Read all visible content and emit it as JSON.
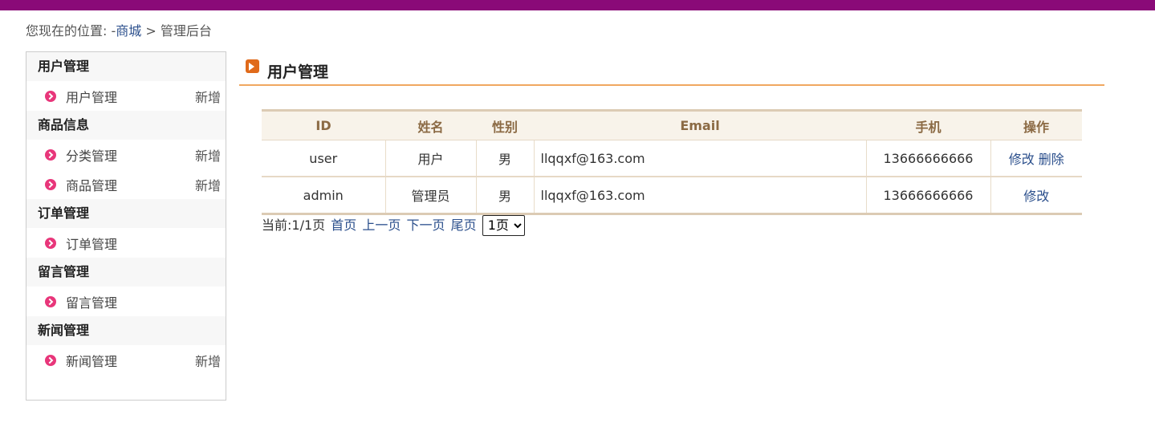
{
  "breadcrumb": {
    "prefix": "您现在的位置: -",
    "link": "商城",
    "separator": " > ",
    "current": "管理后台"
  },
  "sidebar": {
    "groups": [
      {
        "title": "用户管理",
        "items": [
          {
            "label": "用户管理",
            "action": "新增"
          }
        ]
      },
      {
        "title": "商品信息",
        "items": [
          {
            "label": "分类管理",
            "action": "新增"
          },
          {
            "label": "商品管理",
            "action": "新增"
          }
        ]
      },
      {
        "title": "订单管理",
        "items": [
          {
            "label": "订单管理",
            "action": ""
          }
        ]
      },
      {
        "title": "留言管理",
        "items": [
          {
            "label": "留言管理",
            "action": ""
          }
        ]
      },
      {
        "title": "新闻管理",
        "items": [
          {
            "label": "新闻管理",
            "action": "新增"
          }
        ]
      }
    ]
  },
  "main": {
    "title": "用户管理",
    "table": {
      "columns": [
        "ID",
        "姓名",
        "性别",
        "Email",
        "手机",
        "操作"
      ],
      "rows": [
        {
          "id": "user",
          "name": "用户",
          "gender": "男",
          "email": "llqqxf@163.com",
          "phone": "13666666666",
          "edit": "修改",
          "delete": "删除"
        },
        {
          "id": "admin",
          "name": "管理员",
          "gender": "男",
          "email": "llqqxf@163.com",
          "phone": "13666666666",
          "edit": "修改",
          "delete": ""
        }
      ]
    },
    "pager": {
      "status": "当前:1/1页",
      "first": "首页",
      "prev": "上一页",
      "next": "下一页",
      "last": "尾页",
      "selected_page": "1页"
    }
  },
  "colors": {
    "topbar": "#8a0a78",
    "accent": "#f0a860",
    "link": "#2b4f8c",
    "bullet": "#e8367a"
  }
}
